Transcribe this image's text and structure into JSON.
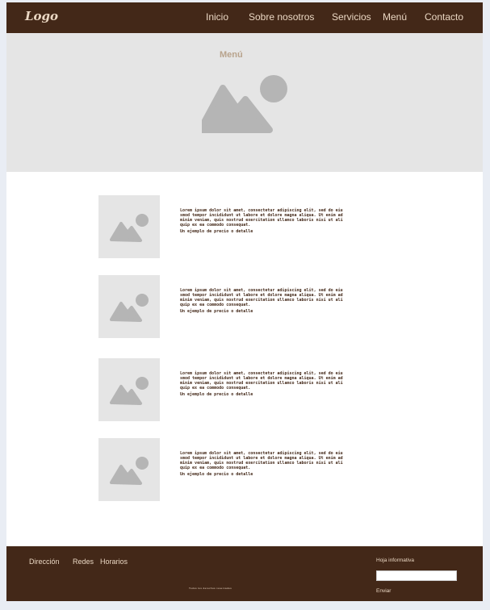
{
  "header": {
    "logo": "Logo",
    "nav": [
      "Inicio",
      "Sobre nosotros",
      "Servicios",
      "Menú",
      "Contacto"
    ]
  },
  "hero": {
    "title": "Menú",
    "image_icon": "image-placeholder-icon"
  },
  "menu_items": [
    {
      "image_icon": "image-placeholder-icon",
      "description": "Lorem ipsum dolor sit amet, consectetur adipiscing elit, sed do eiusmod tempor incididunt ut labore et dolore magna aliqua. Ut enim ad minim veniam, quis nostrud exercitation ullamco laboris nisi ut aliquip ex ea commodo consequat.",
      "meta": "Un ejemplo de precio o detalle"
    },
    {
      "image_icon": "image-placeholder-icon",
      "description": "Lorem ipsum dolor sit amet, consectetur adipiscing elit, sed do eiusmod tempor incididunt ut labore et dolore magna aliqua. Ut enim ad minim veniam, quis nostrud exercitation ullamco laboris nisi ut aliquip ex ea commodo consequat.",
      "meta": "Un ejemplo de precio o detalle"
    },
    {
      "image_icon": "image-placeholder-icon",
      "description": "Lorem ipsum dolor sit amet, consectetur adipiscing elit, sed do eiusmod tempor incididunt ut labore et dolore magna aliqua. Ut enim ad minim veniam, quis nostrud exercitation ullamco laboris nisi ut aliquip ex ea commodo consequat.",
      "meta": "Un ejemplo de precio o detalle"
    },
    {
      "image_icon": "image-placeholder-icon",
      "description": "Lorem ipsum dolor sit amet, consectetur adipiscing elit, sed do eiusmod tempor incididunt ut labore et dolore magna aliqua. Ut enim ad minim veniam, quis nostrud exercitation ullamco laboris nisi ut aliquip ex ea commodo consequat.",
      "meta": "Un ejemplo de precio o detalle"
    }
  ],
  "footer": {
    "links": [
      "Dirección",
      "Redes",
      "Horarios"
    ],
    "newsletter_label": "Hoja informativa",
    "newsletter_placeholder": "",
    "send_label": "Enviar",
    "copyright": "Todos los derechos reservados"
  },
  "colors": {
    "brand_brown": "#432818",
    "accent_cream": "#ead7c3",
    "placeholder_gray": "#e5e5e5",
    "icon_gray": "#b5b5b5"
  }
}
